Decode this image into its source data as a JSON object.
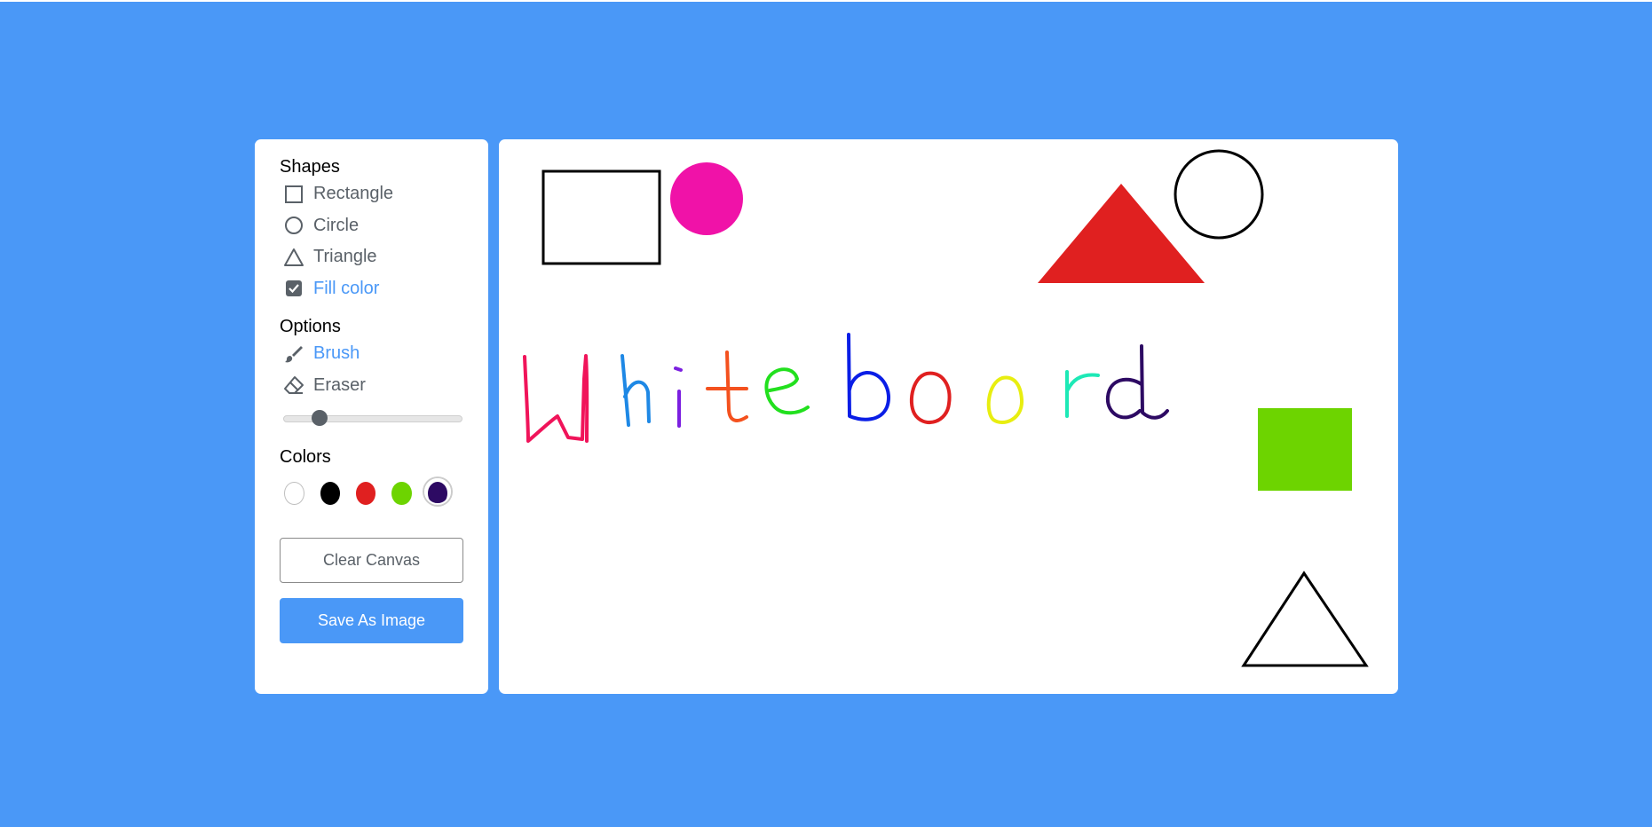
{
  "sidebar": {
    "shapes_title": "Shapes",
    "shapes": [
      {
        "label": "Rectangle",
        "icon": "rectangle-icon",
        "active": false
      },
      {
        "label": "Circle",
        "icon": "circle-icon",
        "active": false
      },
      {
        "label": "Triangle",
        "icon": "triangle-icon",
        "active": false
      },
      {
        "label": "Fill color",
        "icon": "checkbox-checked-icon",
        "active": true
      }
    ],
    "options_title": "Options",
    "options": [
      {
        "label": "Brush",
        "icon": "brush-icon",
        "active": true
      },
      {
        "label": "Eraser",
        "icon": "eraser-icon",
        "active": false
      }
    ],
    "size_slider": {
      "value": 5,
      "min": 1,
      "max": 30
    },
    "colors_title": "Colors",
    "colors": [
      "#ffffff",
      "#000000",
      "#E02020",
      "#6DD400",
      "#2D0A63"
    ],
    "selected_color": "#2D0A63",
    "clear_label": "Clear Canvas",
    "save_label": "Save As Image"
  },
  "canvas": {
    "handwritten_text": "Whiteboard",
    "text_colors": [
      "#F0145A",
      "#1E88E5",
      "#7B1FE0",
      "#F4511E",
      "#22E01E",
      "#0A1EE6",
      "#E02020",
      "#E8EE10",
      "#1DE9B6",
      "#2D0A63"
    ],
    "shape_colors": {
      "pink": "#F012A8",
      "red": "#E02020",
      "green": "#6DD400",
      "stroke": "#000000"
    }
  },
  "theme": {
    "background": "#4A98F7",
    "accent": "#4A98F7",
    "muted_text": "#5A6168"
  }
}
